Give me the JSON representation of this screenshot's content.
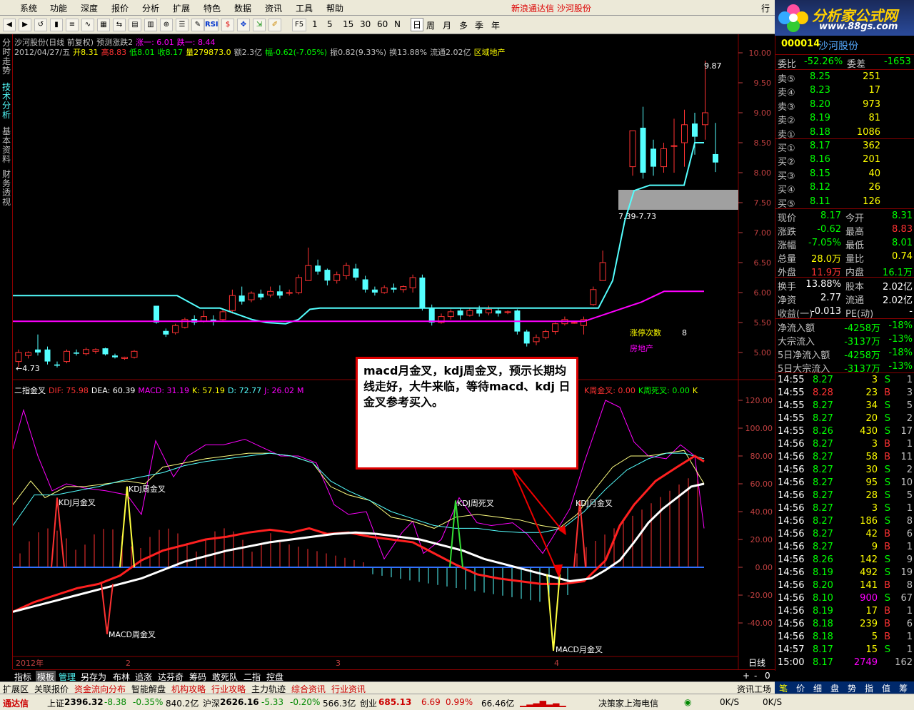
{
  "menubar": {
    "items": [
      "系统",
      "功能",
      "深度",
      "报价",
      "分析",
      "扩展",
      "特色",
      "数据",
      "资讯",
      "工具",
      "帮助"
    ],
    "title": "新浪通达信  沙河股份",
    "right_label": "行"
  },
  "toolbar": {
    "buttons": [
      "RSI",
      "F5",
      "1",
      "5",
      "15",
      "30",
      "60",
      "N",
      "日",
      "周",
      "月",
      "多",
      "季",
      "年"
    ]
  },
  "logo": {
    "line1": "分析家公式网",
    "line2": "www.88gs.com"
  },
  "lefttabs": [
    "分时走势",
    "技术分析",
    "基本资料",
    "财务透视"
  ],
  "chart": {
    "header1": {
      "name": "沙河股份(日线 前复权)",
      "ind": "预测涨跌2",
      "up_label": "涨一: 6.01",
      "down_label": "跌一: 8.44"
    },
    "header2": {
      "date": "2012/04/27/五",
      "open": "开8.31",
      "high": "高8.83",
      "low": "低8.01",
      "close": "收8.17",
      "vol": "量279873.0",
      "amt": "额2.3亿",
      "chg": "幅-0.62(-7.05%)",
      "amp": "振0.82(9.33%)",
      "turn": "换13.88%",
      "flow": "流通2.02亿",
      "sector": "区域地产"
    },
    "header3": {
      "name": "二指金叉",
      "dif": "DIF: 75.98",
      "dea": "DEA: 60.39",
      "macd": "MACD: 31.19",
      "k": "K: 57.19",
      "d": "D: 72.77",
      "j": "J: 26.02",
      "m": "M",
      "kzjc": "K周金叉: 0.00",
      "kzsc": "K周死叉: 0.00",
      "kend": "K"
    },
    "price_axis": [
      "10.00",
      "9.50",
      "9.00",
      "8.50",
      "8.00",
      "7.50",
      "7.00",
      "6.50",
      "6.00",
      "5.50",
      "5.00"
    ],
    "ind_axis": [
      "120.00",
      "100.00",
      "80.00",
      "60.00",
      "40.00",
      "20.00",
      "0.00",
      "-20.00",
      "-40.00"
    ],
    "labels": {
      "hi": "9.87",
      "lo": "←4.73",
      "range": "7.39-7.73",
      "limit_count": "涨停次数",
      "limit_num": "8",
      "sector": "房地产"
    },
    "ind_labels": {
      "kdj_month1": "KDJ月金叉",
      "kdj_month2": "KDJ月金叉",
      "kdj_week_gold": "KDJ周金叉",
      "kdj_week_dead": "KDJ周死叉",
      "macd_week": "MACD周金叉",
      "macd_month": "MACD月金叉"
    },
    "date_axis": [
      "2012年",
      "2",
      "3",
      "4"
    ],
    "period_label": "日线",
    "colors": {
      "up": "#ff3232",
      "down": "#54ffff",
      "ma": "#54ffff",
      "ma2": "#ff00ff"
    }
  },
  "annotation": "macd月金叉，kdj周金叉，预示长期均线走好，大牛来临，等待macd、kdj 日金叉参考买入。",
  "panel": {
    "code": "000014",
    "name": "沙河股份",
    "weibi_label": "委比",
    "weibi": "-52.26%",
    "weicha_label": "委差",
    "weicha": "-1653",
    "sells": [
      {
        "label": "卖⑤",
        "price": "8.25",
        "vol": "251"
      },
      {
        "label": "卖④",
        "price": "8.23",
        "vol": "17"
      },
      {
        "label": "卖③",
        "price": "8.20",
        "vol": "973"
      },
      {
        "label": "卖②",
        "price": "8.19",
        "vol": "81"
      },
      {
        "label": "卖①",
        "price": "8.18",
        "vol": "1086"
      }
    ],
    "buys": [
      {
        "label": "买①",
        "price": "8.17",
        "vol": "362"
      },
      {
        "label": "买②",
        "price": "8.16",
        "vol": "201"
      },
      {
        "label": "买③",
        "price": "8.15",
        "vol": "40"
      },
      {
        "label": "买④",
        "price": "8.12",
        "vol": "26"
      },
      {
        "label": "买⑤",
        "price": "8.11",
        "vol": "126"
      }
    ],
    "stats": [
      {
        "l1": "现价",
        "v1": "8.17",
        "c1": "#00ff00",
        "l2": "今开",
        "v2": "8.31",
        "c2": "#00ff00"
      },
      {
        "l1": "涨跌",
        "v1": "-0.62",
        "c1": "#00ff00",
        "l2": "最高",
        "v2": "8.83",
        "c2": "#ff3232"
      },
      {
        "l1": "涨幅",
        "v1": "-7.05%",
        "c1": "#00ff00",
        "l2": "最低",
        "v2": "8.01",
        "c2": "#00ff00"
      },
      {
        "l1": "总量",
        "v1": "28.0万",
        "c1": "#ffff00",
        "l2": "量比",
        "v2": "0.74",
        "c2": "#ffff00"
      },
      {
        "l1": "外盘",
        "v1": "11.9万",
        "c1": "#ff3232",
        "l2": "内盘",
        "v2": "16.1万",
        "c2": "#00ff00"
      }
    ],
    "stats2": [
      {
        "l1": "换手",
        "v1": "13.88%",
        "c1": "#ffffff",
        "l2": "股本",
        "v2": "2.02亿",
        "c2": "#ffffff"
      },
      {
        "l1": "净资",
        "v1": "2.77",
        "c1": "#ffffff",
        "l2": "流通",
        "v2": "2.02亿",
        "c2": "#ffffff"
      },
      {
        "l1": "收益(一)",
        "v1": "-0.013",
        "c1": "#ffffff",
        "l2": "PE(动)",
        "v2": "-",
        "c2": "#ffffff"
      }
    ],
    "flows": [
      {
        "label": "净流入额",
        "v1": "-4258万",
        "v2": "-18%"
      },
      {
        "label": "大宗流入",
        "v1": "-3137万",
        "v2": "-13%"
      },
      {
        "label": "5日净流入额",
        "v1": "-4258万",
        "v2": "-18%"
      },
      {
        "label": "5日大宗流入",
        "v1": "-3137万",
        "v2": "-13%"
      }
    ],
    "ticks": [
      {
        "t": "14:55",
        "p": "8.27",
        "v": "3",
        "s": "S",
        "n": "1"
      },
      {
        "t": "14:55",
        "p": "8.28",
        "v": "23",
        "s": "B",
        "n": "3"
      },
      {
        "t": "14:55",
        "p": "8.27",
        "v": "34",
        "s": "S",
        "n": "5"
      },
      {
        "t": "14:55",
        "p": "8.27",
        "v": "20",
        "s": "S",
        "n": "2"
      },
      {
        "t": "14:55",
        "p": "8.26",
        "v": "430",
        "s": "S",
        "n": "17"
      },
      {
        "t": "14:56",
        "p": "8.27",
        "v": "3",
        "s": "B",
        "n": "1"
      },
      {
        "t": "14:56",
        "p": "8.27",
        "v": "58",
        "s": "B",
        "n": "11"
      },
      {
        "t": "14:56",
        "p": "8.27",
        "v": "30",
        "s": "S",
        "n": "2"
      },
      {
        "t": "14:56",
        "p": "8.27",
        "v": "95",
        "s": "S",
        "n": "10"
      },
      {
        "t": "14:56",
        "p": "8.27",
        "v": "28",
        "s": "S",
        "n": "5"
      },
      {
        "t": "14:56",
        "p": "8.27",
        "v": "3",
        "s": "S",
        "n": "1"
      },
      {
        "t": "14:56",
        "p": "8.27",
        "v": "186",
        "s": "S",
        "n": "8"
      },
      {
        "t": "14:56",
        "p": "8.27",
        "v": "42",
        "s": "B",
        "n": "6"
      },
      {
        "t": "14:56",
        "p": "8.27",
        "v": "9",
        "s": "B",
        "n": "1"
      },
      {
        "t": "14:56",
        "p": "8.26",
        "v": "142",
        "s": "S",
        "n": "9"
      },
      {
        "t": "14:56",
        "p": "8.19",
        "v": "492",
        "s": "S",
        "n": "19"
      },
      {
        "t": "14:56",
        "p": "8.20",
        "v": "141",
        "s": "B",
        "n": "8"
      },
      {
        "t": "14:56",
        "p": "8.10",
        "v": "900",
        "s": "S",
        "n": "67"
      },
      {
        "t": "14:56",
        "p": "8.19",
        "v": "17",
        "s": "B",
        "n": "1"
      },
      {
        "t": "14:56",
        "p": "8.18",
        "v": "239",
        "s": "B",
        "n": "6"
      },
      {
        "t": "14:56",
        "p": "8.18",
        "v": "5",
        "s": "B",
        "n": "1"
      },
      {
        "t": "14:57",
        "p": "8.17",
        "v": "15",
        "s": "S",
        "n": "1"
      },
      {
        "t": "15:00",
        "p": "8.17",
        "v": "2749",
        "s": "",
        "n": "162"
      }
    ]
  },
  "bottomtabs": [
    "指标",
    "模板",
    "管理",
    "另存为",
    "布林",
    "追涨",
    "达芬奇",
    "筹码",
    "敢死队",
    "二指",
    "控盘"
  ],
  "footer1": [
    "扩展区",
    "关联报价",
    "资金流向分布",
    "智能解盘",
    "机构攻略",
    "行业攻略",
    "主力轨迹",
    "综合资讯",
    "行业资讯"
  ],
  "footer1_right": "资讯工场",
  "rtabs": [
    "笔",
    "价",
    "细",
    "盘",
    "势",
    "指",
    "值",
    "筹"
  ],
  "footer2": {
    "brand": "通达信",
    "sh_label": "上证",
    "sh": "2396.32",
    "sh_chg": "-8.38",
    "sh_pct": "-0.35%",
    "sh_amt": "840.2亿",
    "sz_label": "沪深",
    "sz": "2626.16",
    "sz_chg": "-5.33",
    "sz_pct": "-0.20%",
    "sz_amt": "566.3亿",
    "cy_label": "创业",
    "cy": "685.13",
    "cy_chg": "6.69",
    "cy_pct": "0.99%",
    "cy_amt": "66.46亿",
    "server": "决策家上海电信",
    "speed1": "0K/S",
    "speed2": "0K/S"
  }
}
